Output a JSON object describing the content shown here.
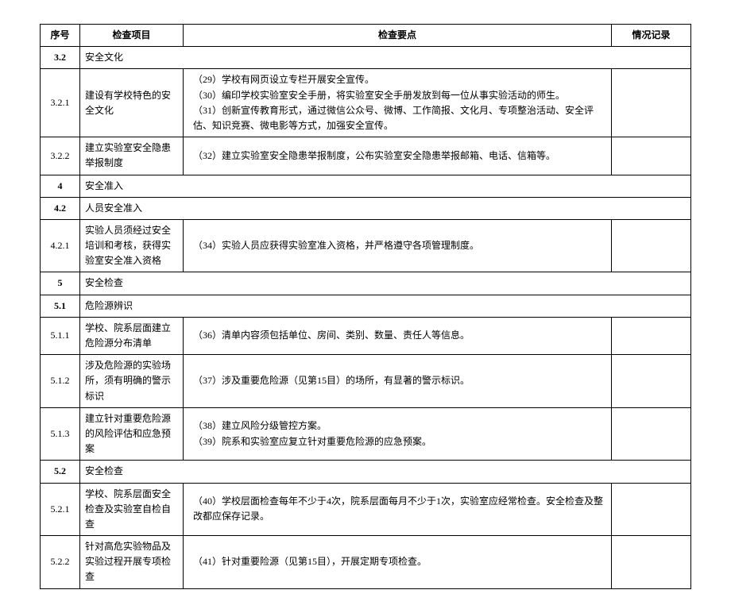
{
  "headers": {
    "seq": "序号",
    "item": "检查项目",
    "key": "检查要点",
    "record": "情况记录"
  },
  "rows": [
    {
      "seq": "3.2",
      "section": "安全文化"
    },
    {
      "seq": "3.2.1",
      "item": "建设有学校特色的安全文化",
      "points": [
        "（29）学校有网页设立专栏开展安全宣传。",
        "（30）编印学校实验室安全手册，将实验室安全手册发放到每一位从事实验活动的师生。",
        "（31）创新宣传教育形式，通过微信公众号、微博、工作简报、文化月、专项整治活动、安全评估、知识竞赛、微电影等方式，加强安全宣传。"
      ]
    },
    {
      "seq": "3.2.2",
      "item": "建立实验室安全隐患举报制度",
      "points": [
        "（32）建立实验室安全隐患举报制度，公布实验室安全隐患举报邮箱、电话、信箱等。"
      ]
    },
    {
      "seq": "4",
      "section": "安全准入"
    },
    {
      "seq": "4.2",
      "section": "人员安全准入"
    },
    {
      "seq": "4.2.1",
      "item": "实验人员须经过安全培训和考核，获得实验室安全准入资格",
      "points": [
        "（34）实验人员应获得实验室准入资格，并严格遵守各项管理制度。"
      ]
    },
    {
      "seq": "5",
      "section": "安全检查"
    },
    {
      "seq": "5.1",
      "section": "危险源辨识"
    },
    {
      "seq": "5.1.1",
      "item": "学校、院系层面建立危险源分布清单",
      "points": [
        "（36）清单内容须包括单位、房间、类别、数量、责任人等信息。"
      ]
    },
    {
      "seq": "5.1.2",
      "item": "涉及危险源的实验场所，须有明确的警示标识",
      "points": [
        "（37）涉及重要危险源（见第15目）的场所，有显著的警示标识。"
      ]
    },
    {
      "seq": "5.1.3",
      "item": "建立针对重要危险源的风险评估和应急预案",
      "points": [
        "（38）建立风险分级管控方案。",
        "（39）院系和实验室应复立针对重要危险源的应急预案。"
      ]
    },
    {
      "seq": "5.2",
      "section": "安全检查"
    },
    {
      "seq": "5.2.1",
      "item": "学校、院系层面安全检查及实验室自检自查",
      "points": [
        "（40）学校层面检查每年不少于4次，院系层面每月不少于1次，实验室应经常检查。安全检查及整改都应保存记录。"
      ]
    },
    {
      "seq": "5.2.2",
      "item": "针对高危实验物品及实验过程开展专项检查",
      "points": [
        "（41）针对重要险源（见第15目），开展定期专项检查。"
      ]
    }
  ]
}
